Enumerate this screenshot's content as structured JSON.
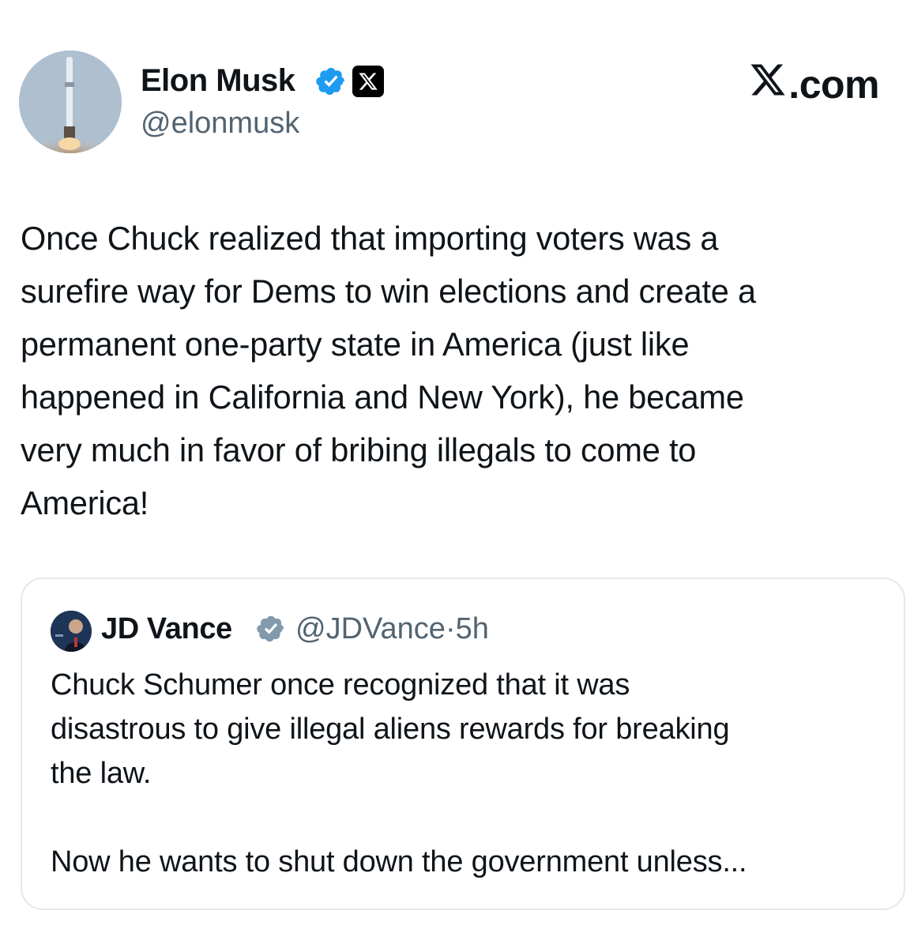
{
  "author": {
    "name": "Elon Musk",
    "handle": "@elonmusk",
    "verified": true,
    "affiliation_badge": "x-logo-icon"
  },
  "brand": {
    "label": ".com"
  },
  "tweet": {
    "text": "Once Chuck realized that importing voters was a\nsurefire way for Dems to win elections and create a\npermanent one-party state in America (just like\nhappened in California and New York), he became\nvery much in favor of bribing illegals to come to\nAmerica!"
  },
  "quoted_tweet": {
    "name": "JD Vance",
    "handle": "@JDVance",
    "separator": "·",
    "time": "5h",
    "verified": true,
    "text": "Chuck Schumer once recognized that it was\ndisastrous to give illegal aliens rewards for breaking\nthe law.\n\nNow he wants to shut down the government unless..."
  },
  "colors": {
    "verified_blue": "#1d9bf0",
    "verified_gray": "#829aab",
    "secondary_text": "#536471",
    "border": "#e3e8ec"
  }
}
